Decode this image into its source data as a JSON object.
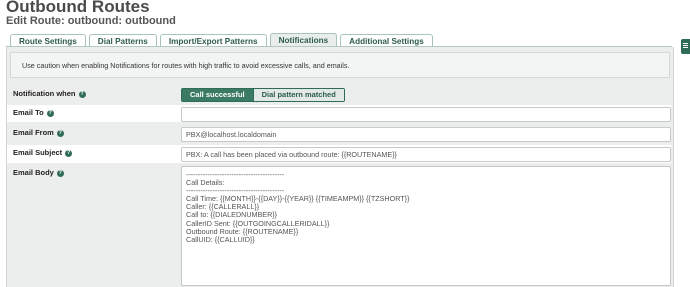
{
  "header": {
    "title": "Outbound Routes",
    "subtitle": "Edit Route: outbound: outbound"
  },
  "tabs": [
    {
      "label": "Route Settings"
    },
    {
      "label": "Dial Patterns"
    },
    {
      "label": "Import/Export Patterns"
    },
    {
      "label": "Notifications"
    },
    {
      "label": "Additional Settings"
    }
  ],
  "active_tab": "Notifications",
  "alert": {
    "text": "Use caution when enabling Notifications for routes with high traffic to avoid excessive calls, and emails."
  },
  "form": {
    "notification_when": {
      "label": "Notification when",
      "options": [
        "Call successful",
        "Dial pattern matched"
      ],
      "selected": "Call successful"
    },
    "email_to": {
      "label": "Email To",
      "value": ""
    },
    "email_from": {
      "label": "Email From",
      "placeholder": "PBX@localhost.localdomain"
    },
    "email_subject": {
      "label": "Email Subject",
      "placeholder": "PBX: A call has been placed via outbound route: {{ROUTENAME}}"
    },
    "email_body": {
      "label": "Email Body",
      "lines": [
        "-----------------------------------------",
        "Call Details:",
        "-----------------------------------------",
        "Call Time: {{MONTH}}-{{DAY}}-{{YEAR}} {{TIMEAMPM}} {{TZSHORT}}",
        "Caller: {{CALLERALL}}",
        "Call to: {{DIALEDNUMBER}}",
        "CallerID Sent: {{OUTGOINGCALLERIDALL}}",
        "Outbound Route: {{ROUTENAME}}",
        "CallUID: {{CALLUID}}"
      ]
    }
  },
  "icons": {
    "help": "help-circle-icon",
    "side_menu": "menu-icon"
  },
  "colors": {
    "accent": "#3c7b63",
    "tab_text": "#2d5c4c",
    "panel_bg": "#eceeed"
  }
}
